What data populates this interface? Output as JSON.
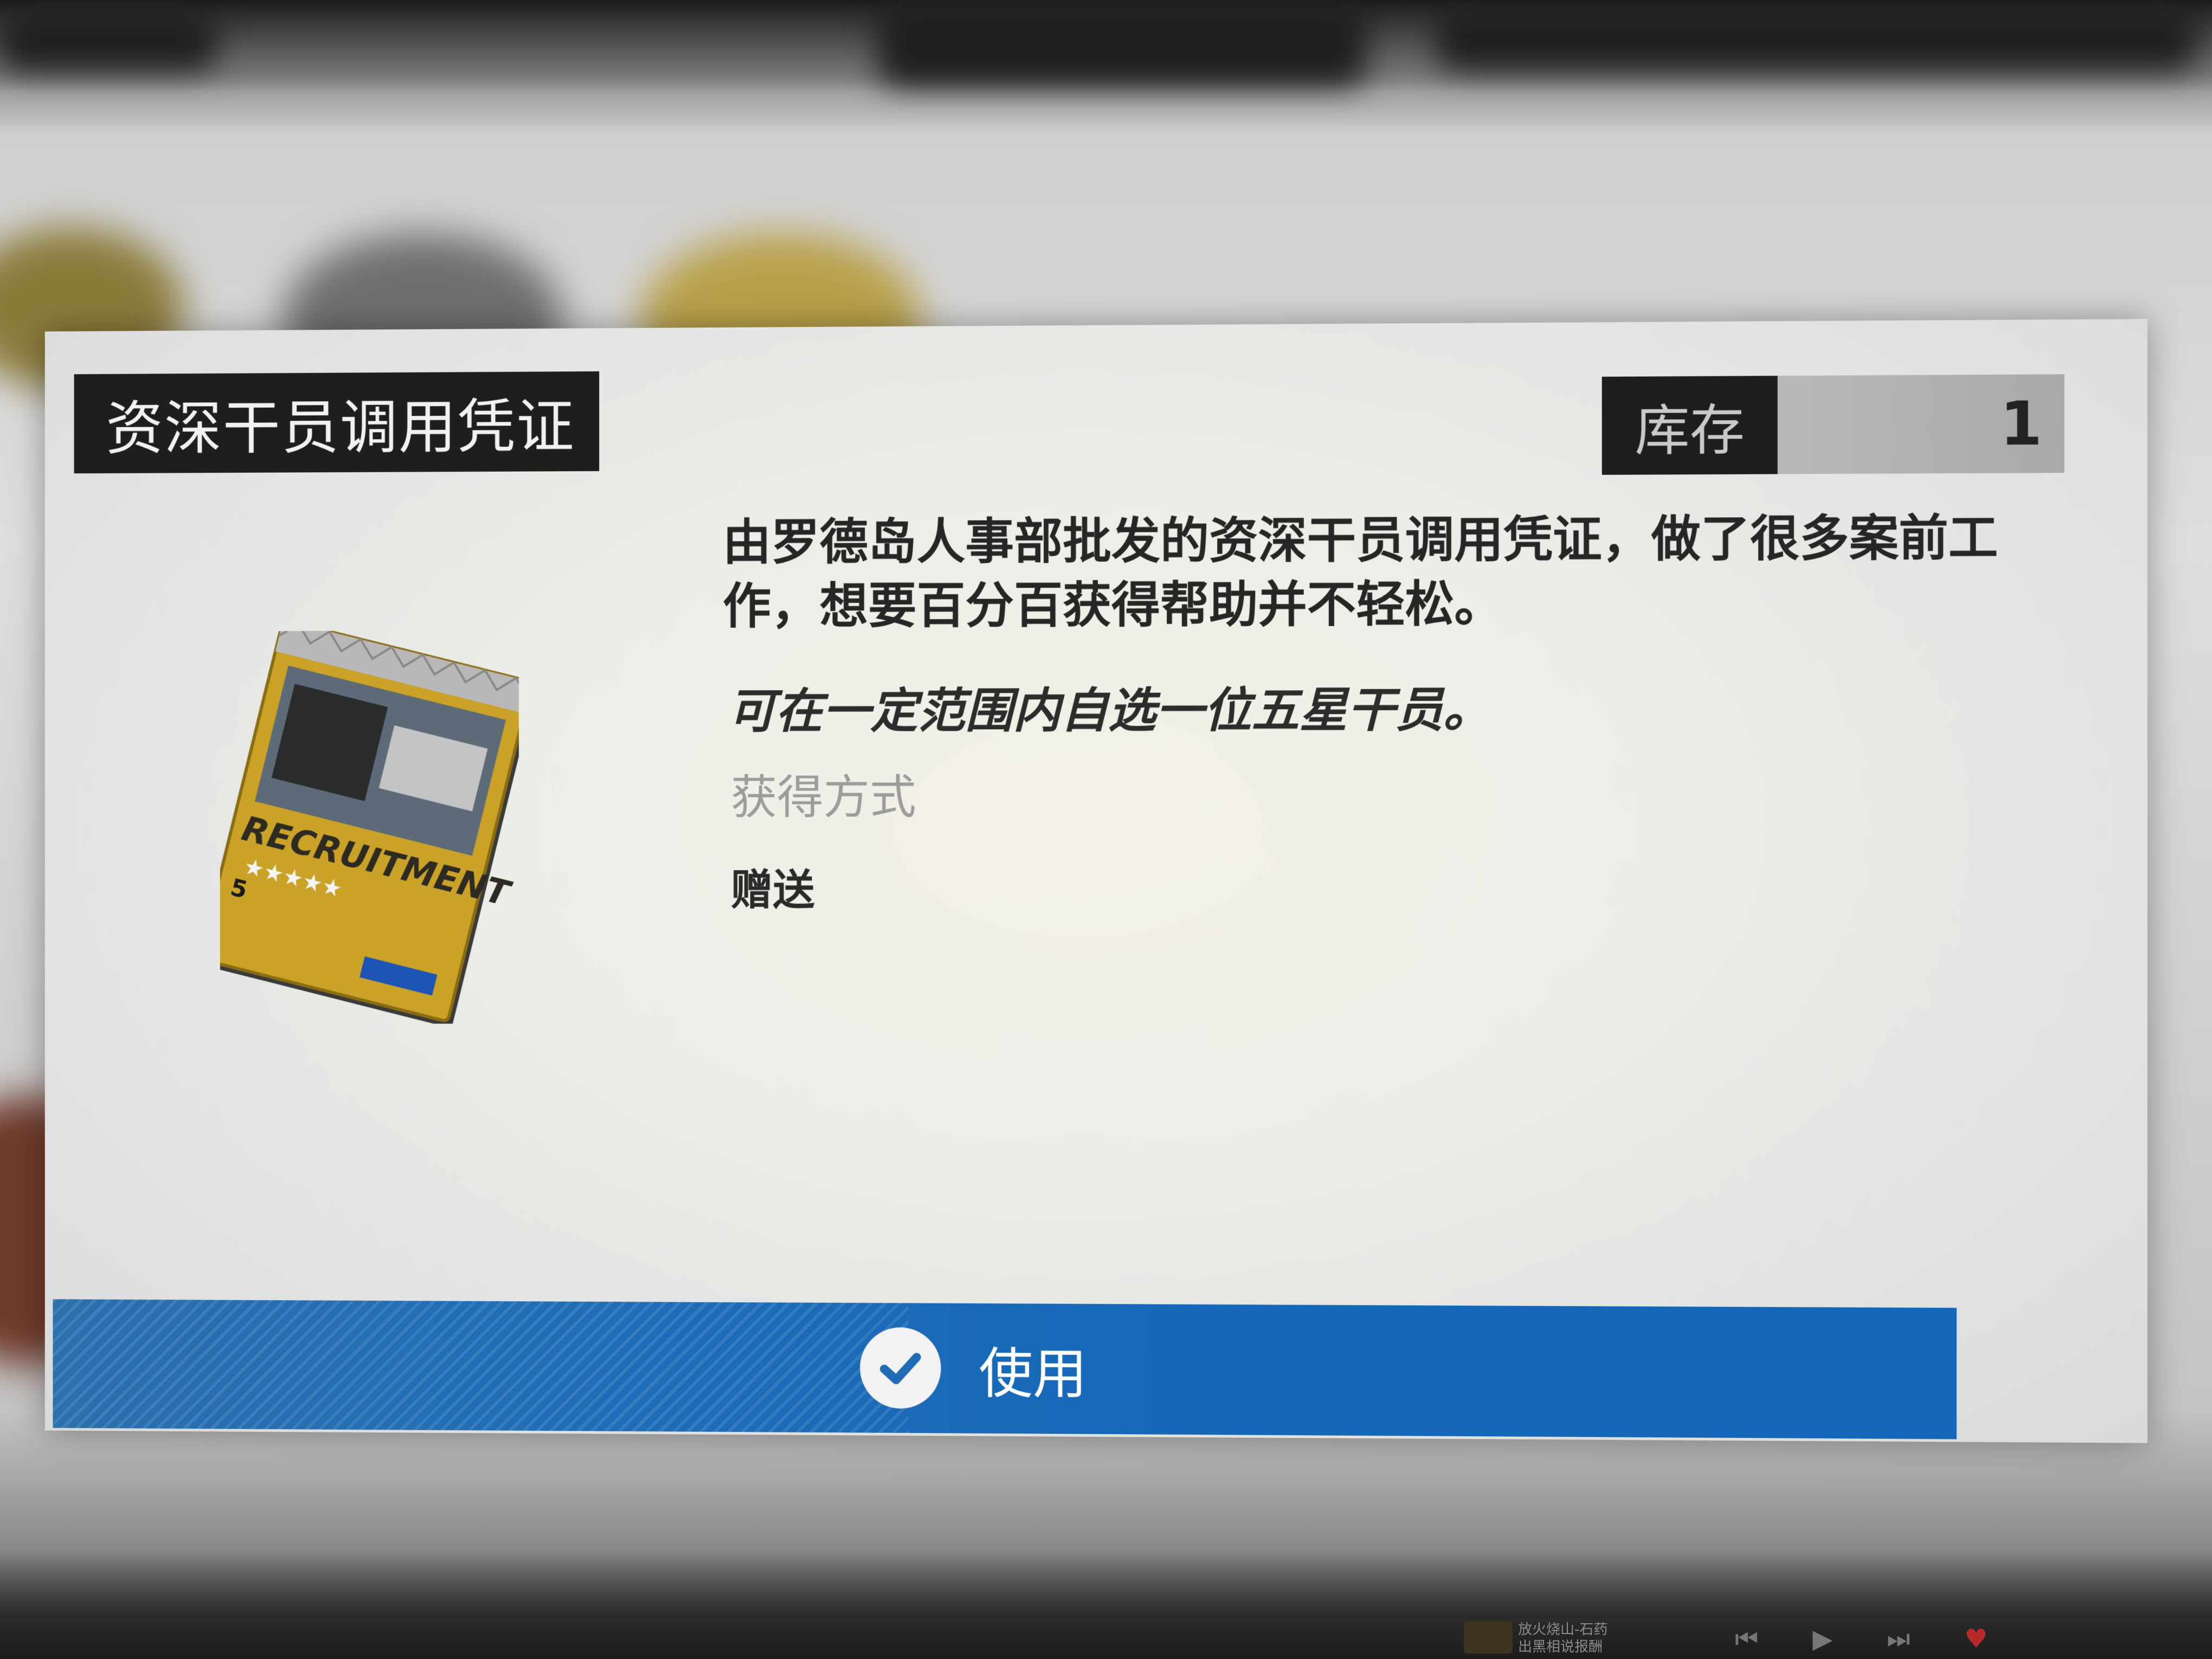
{
  "dialog": {
    "title": "资深干员调用凭证",
    "stock": {
      "label": "库存",
      "value": "1"
    },
    "description": "由罗德岛人事部批发的资深干员调用凭证，做了很多案前工作，想要百分百获得帮助并不轻松。",
    "effect": "可在一定范围内自选一位五星干员。",
    "obtain_label": "获得方式",
    "obtain_value": "赠送",
    "item_image": {
      "label": "RECRUITMENT",
      "stars": "★★★★★",
      "rarity": "5"
    },
    "use_button": {
      "label": "使用",
      "icon": "check-icon"
    }
  },
  "taskbar": {
    "now_playing": "放火烧山-石药\n出黑相说报酬",
    "controls": [
      "previous-icon",
      "play-icon",
      "next-icon",
      "heart-icon"
    ]
  },
  "colors": {
    "use_bar": "#1567b8",
    "title_bg": "#1e1e1e",
    "item_gold": "#c9a227"
  }
}
